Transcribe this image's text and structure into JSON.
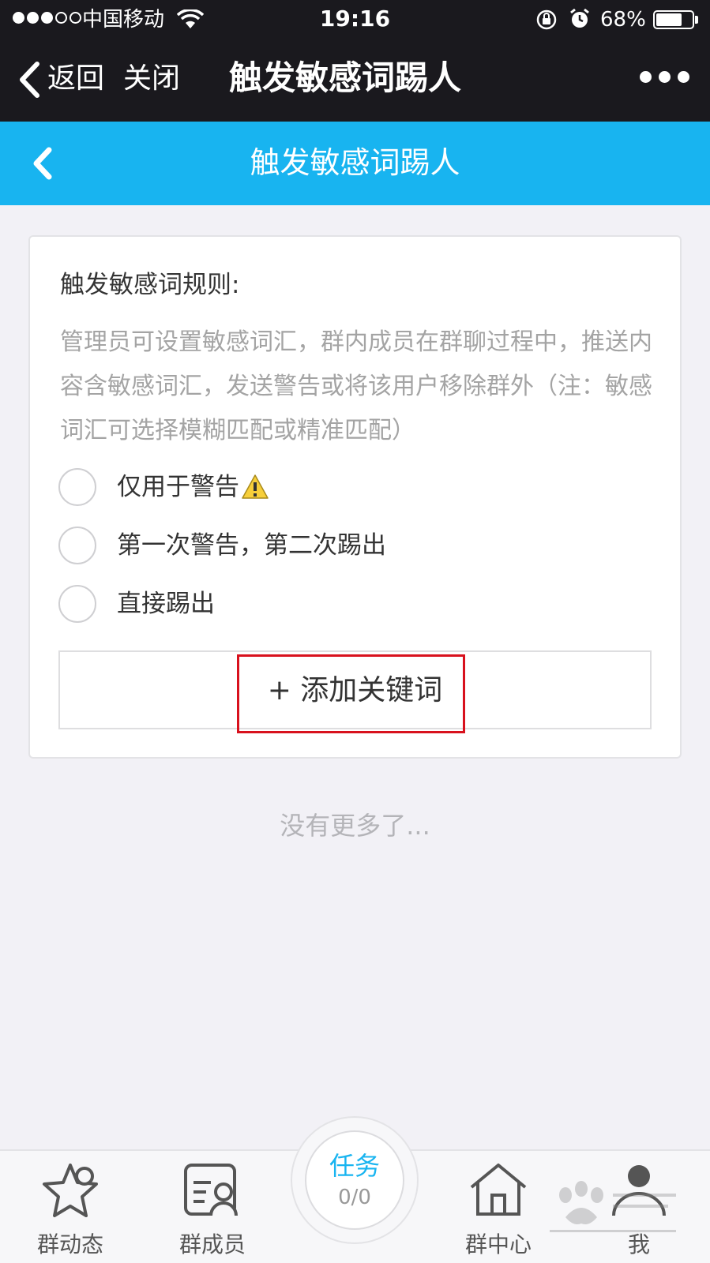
{
  "status_bar": {
    "carrier": "中国移动",
    "time": "19:16",
    "battery_percent": "68%",
    "battery_level": 0.68,
    "signal_bars_filled": 3,
    "signal_bars_total": 5
  },
  "nav_bar": {
    "back_label": "返回",
    "close_label": "关闭",
    "title": "触发敏感词踢人",
    "more_icon": "more-dots-icon"
  },
  "header": {
    "title": "触发敏感词踢人",
    "back_icon": "chevron-left-icon"
  },
  "rules": {
    "title": "触发敏感词规则:",
    "description": "管理员可设置敏感词汇，群内成员在群聊过程中，推送内容含敏感词汇，发送警告或将该用户移除群外（注：敏感词汇可选择模糊匹配或精准匹配）",
    "options": [
      {
        "label": "仅用于警告",
        "icon": "warning-icon",
        "selected": false
      },
      {
        "label": "第一次警告，第二次踢出",
        "selected": false
      },
      {
        "label": "直接踢出",
        "selected": false
      }
    ],
    "add_keyword_label": "+ 添加关键词"
  },
  "footer_note": "没有更多了...",
  "tab_bar": {
    "items": [
      {
        "label": "群动态",
        "icon": "star-icon"
      },
      {
        "label": "群成员",
        "icon": "member-card-icon"
      },
      {
        "label": "群中心",
        "icon": "house-icon"
      },
      {
        "label": "我",
        "icon": "person-icon"
      }
    ],
    "task": {
      "label": "任务",
      "count": "0/0"
    }
  },
  "colors": {
    "status_nav_bg": "#1a191e",
    "header_blue": "#18b4f0",
    "highlight_red": "#d8111d",
    "page_bg": "#f2f1f6"
  }
}
